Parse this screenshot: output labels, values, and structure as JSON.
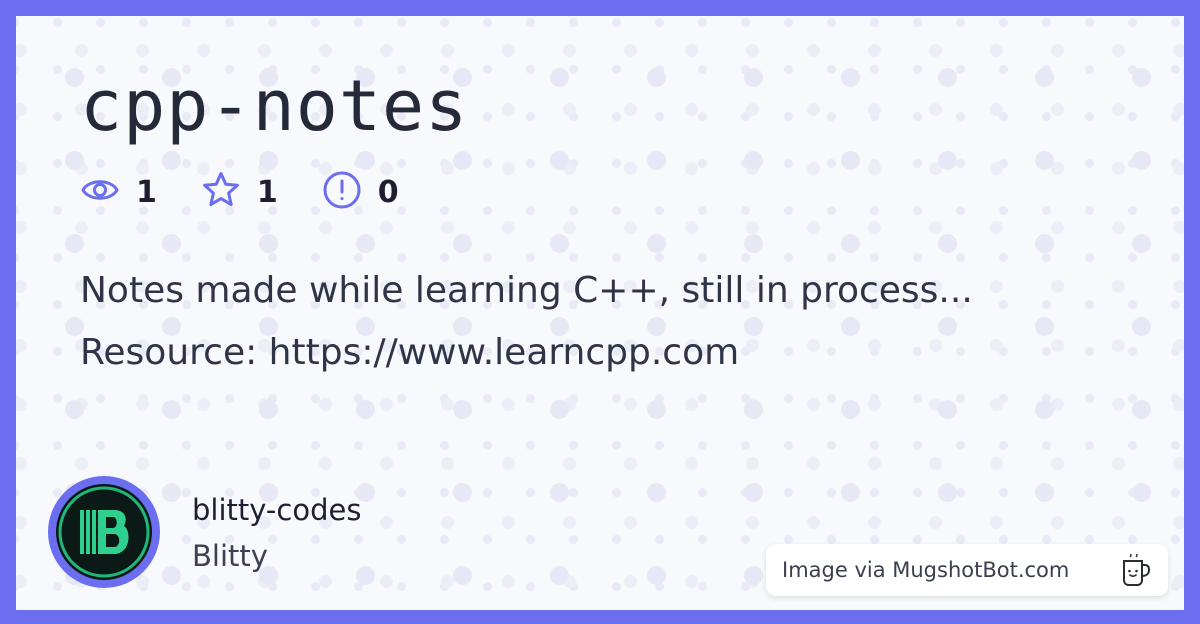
{
  "repo": {
    "title": "cpp-notes",
    "description_lines": [
      "Notes made while learning C++, still in process...",
      "Resource: https://www.learncpp.com"
    ]
  },
  "stats": {
    "watchers": "1",
    "stars": "1",
    "issues": "0"
  },
  "icons": {
    "watchers": "eye-icon",
    "stars": "star-icon",
    "issues": "alert-circle-icon",
    "credit": "mug-icon"
  },
  "owner": {
    "login": "blitty-codes",
    "name": "Blitty"
  },
  "credit": {
    "text": "Image via MugshotBot.com"
  },
  "colors": {
    "accent": "#6c6ef0",
    "background": "#f8f9fc",
    "text": "#252a3a"
  }
}
